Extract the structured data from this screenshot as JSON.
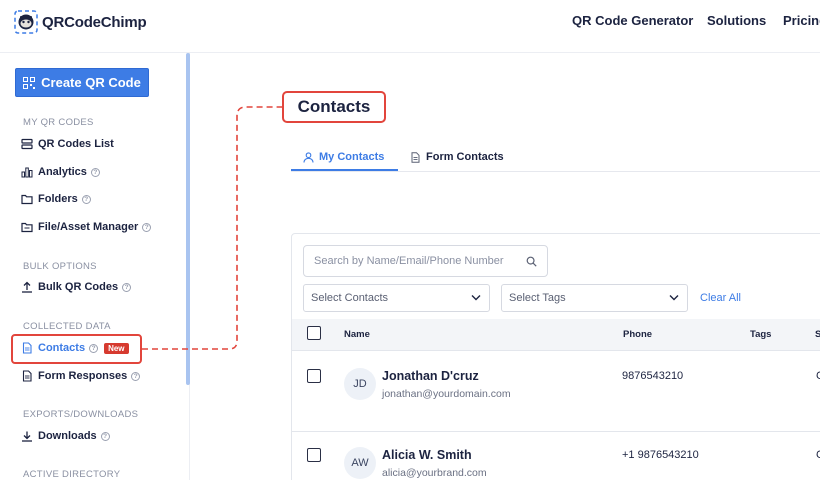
{
  "brand": {
    "name": "QRCodeChimp"
  },
  "topnav": [
    {
      "label": "QR Code Generator"
    },
    {
      "label": "Solutions"
    },
    {
      "label": "Pricing"
    }
  ],
  "sidebar": {
    "create_button": "Create QR Code",
    "sections": [
      {
        "title": "MY QR CODES",
        "items": [
          {
            "label": "QR Codes List",
            "icon": "list-icon"
          },
          {
            "label": "Analytics",
            "icon": "bar-chart-icon",
            "help": true
          },
          {
            "label": "Folders",
            "icon": "folder-icon",
            "help": true
          },
          {
            "label": "File/Asset Manager",
            "icon": "folder-file-icon",
            "help": true
          }
        ]
      },
      {
        "title": "BULK OPTIONS",
        "items": [
          {
            "label": "Bulk QR Codes",
            "icon": "upload-icon",
            "help": true
          }
        ]
      },
      {
        "title": "COLLECTED DATA",
        "items": [
          {
            "label": "Contacts",
            "icon": "document-icon",
            "help": true,
            "badge": "New",
            "highlighted": true
          },
          {
            "label": "Form Responses",
            "icon": "document-icon",
            "help": true
          }
        ]
      },
      {
        "title": "EXPORTS/DOWNLOADS",
        "items": [
          {
            "label": "Downloads",
            "icon": "download-icon",
            "help": true
          }
        ]
      },
      {
        "title": "ACTIVE DIRECTORY",
        "items": []
      }
    ],
    "help_glyph": "?"
  },
  "page": {
    "title": "Contacts",
    "tabs": [
      {
        "label": "My Contacts",
        "icon": "user-icon",
        "active": true
      },
      {
        "label": "Form Contacts",
        "icon": "document-icon",
        "active": false
      }
    ]
  },
  "filters": {
    "search_placeholder": "Search by Name/Email/Phone Number",
    "select_contacts": "Select Contacts",
    "select_tags": "Select Tags",
    "clear_all": "Clear All"
  },
  "table": {
    "columns": [
      "Name",
      "Phone",
      "Tags",
      "S"
    ],
    "rows": [
      {
        "initials": "JD",
        "name": "Jonathan D'cruz",
        "email": "jonathan@yourdomain.com",
        "phone": "9876543210",
        "tags": "",
        "cut": "C"
      },
      {
        "initials": "AW",
        "name": "Alicia W. Smith",
        "email": "alicia@yourbrand.com",
        "phone": "+1 9876543210",
        "tags": "",
        "cut": "C"
      }
    ]
  },
  "colors": {
    "accent": "#3d7ce5",
    "highlight": "#e2453c",
    "badge": "#d63a2f",
    "text": "#1c2340"
  }
}
